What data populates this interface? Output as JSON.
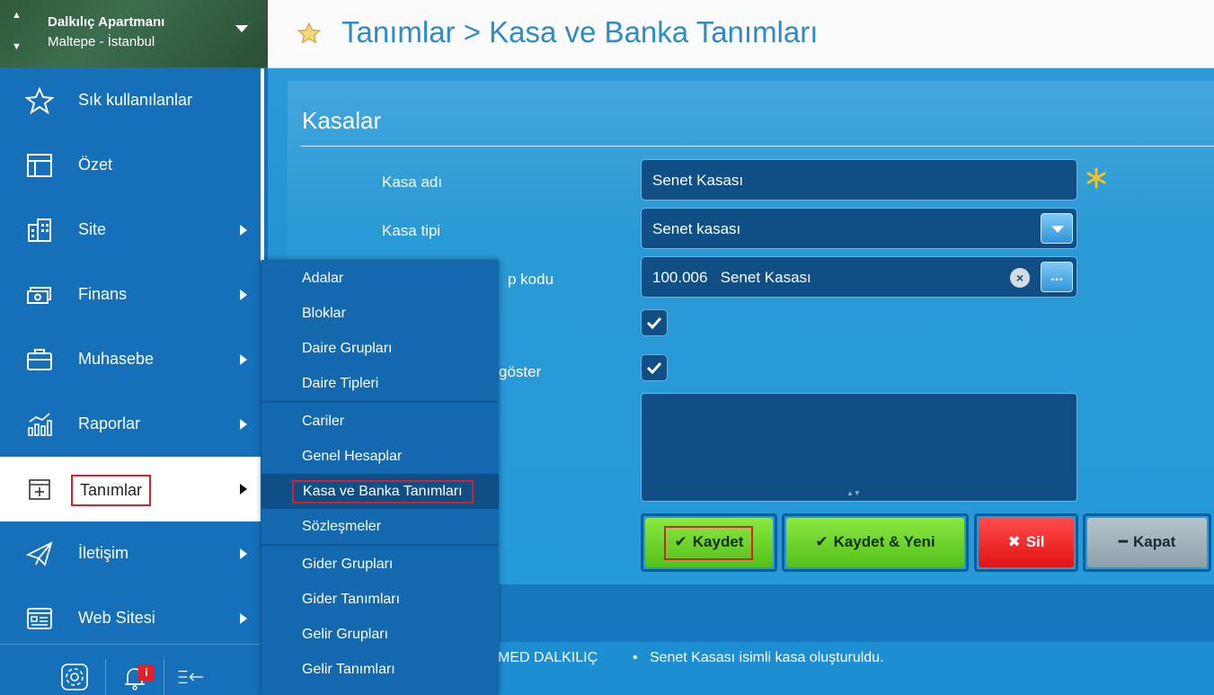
{
  "org": {
    "name": "Dalkılıç Apartmanı",
    "location": "Maltepe - İstanbul"
  },
  "sidebar": {
    "items": [
      {
        "label": "Sık kullanılanlar",
        "icon": "star-icon"
      },
      {
        "label": "Özet",
        "icon": "dashboard-icon"
      },
      {
        "label": "Site",
        "icon": "building-icon"
      },
      {
        "label": "Finans",
        "icon": "money-icon"
      },
      {
        "label": "Muhasebe",
        "icon": "briefcase-icon"
      },
      {
        "label": "Raporlar",
        "icon": "chart-icon"
      },
      {
        "label": "Tanımlar",
        "icon": "definitions-icon",
        "active": true
      },
      {
        "label": "İletişim",
        "icon": "paper-plane-icon"
      },
      {
        "label": "Web Sitesi",
        "icon": "website-icon"
      }
    ],
    "footer": {
      "notification_badge": "i"
    }
  },
  "header": {
    "breadcrumb": "Tanımlar > Kasa ve Banka Tanımları"
  },
  "submenu": {
    "items": [
      "Adalar",
      "Bloklar",
      "Daire Grupları",
      "Daire Tipleri",
      "Cariler",
      "Genel Hesaplar",
      "Kasa ve Banka Tanımları",
      "Sözleşmeler",
      "Gider Grupları",
      "Gider Tanımları",
      "Gelir Grupları",
      "Gelir Tanımları"
    ],
    "selected": "Kasa ve Banka Tanımları"
  },
  "form": {
    "title": "Kasalar",
    "labels": {
      "name": "Kasa adı",
      "type": "Kasa tipi",
      "account_partial": "p kodu",
      "show_partial": "göster"
    },
    "values": {
      "name": "Senet Kasası",
      "type": "Senet kasası",
      "account": "100.006   Senet Kasası"
    },
    "checkbox1": true,
    "checkbox2": true
  },
  "buttons": {
    "save": "Kaydet",
    "save_new": "Kaydet & Yeni",
    "delete": "Sil",
    "close": "Kapat"
  },
  "status": {
    "user_partial": "MED DALKILIÇ",
    "message": "Senet Kasası isimli kasa oluşturuldu."
  },
  "colors": {
    "accent": "#1570b9",
    "highlight": "#d8202a",
    "save": "#55c01a",
    "delete": "#e01414"
  }
}
